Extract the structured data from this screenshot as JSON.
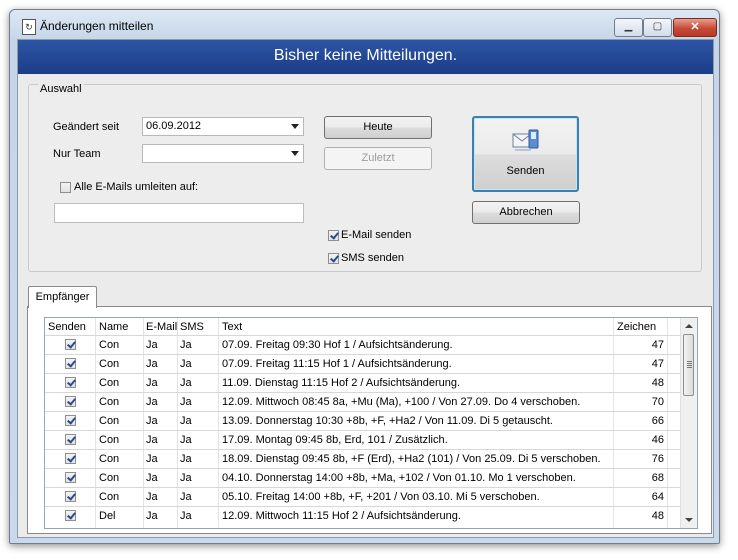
{
  "window": {
    "title": "Änderungen mitteilen",
    "app_icon_glyph": "↻"
  },
  "window_buttons": {
    "minimize": "▁",
    "maximize": "▢",
    "close": "✕"
  },
  "banner": "Bisher keine Mitteilungen.",
  "auswahl": {
    "legend": "Auswahl",
    "changed_since_label": "Geändert seit",
    "changed_since_value": "06.09.2012",
    "team_label": "Nur Team",
    "team_value": "",
    "redirect_label": "Alle E-Mails umleiten auf:",
    "redirect_checked": false,
    "redirect_value": "",
    "today_button": "Heute",
    "last_button": "Zuletzt",
    "email_send_label": "E-Mail senden",
    "email_send_checked": true,
    "sms_send_label": "SMS senden",
    "sms_send_checked": true,
    "send_button": "Senden",
    "cancel_button": "Abbrechen"
  },
  "tab": {
    "label": "Empfänger"
  },
  "table": {
    "columns": [
      "Senden",
      "Name",
      "E-Mail",
      "SMS",
      "Text",
      "Zeichen"
    ],
    "rows": [
      {
        "send": true,
        "name": "Con",
        "email": "Ja",
        "sms": "Ja",
        "text": "07.09. Freitag 09:30 Hof 1 / Aufsichtsänderung.",
        "chars": "47"
      },
      {
        "send": true,
        "name": "Con",
        "email": "Ja",
        "sms": "Ja",
        "text": "07.09. Freitag 11:15 Hof 1 / Aufsichtsänderung.",
        "chars": "47"
      },
      {
        "send": true,
        "name": "Con",
        "email": "Ja",
        "sms": "Ja",
        "text": "11.09. Dienstag 11:15 Hof 2 / Aufsichtsänderung.",
        "chars": "48"
      },
      {
        "send": true,
        "name": "Con",
        "email": "Ja",
        "sms": "Ja",
        "text": "12.09. Mittwoch 08:45 8a, +Mu (Ma), +100 / Von 27.09. Do 4 verschoben.",
        "chars": "70"
      },
      {
        "send": true,
        "name": "Con",
        "email": "Ja",
        "sms": "Ja",
        "text": "13.09. Donnerstag 10:30 +8b, +F, +Ha2 / Von 11.09. Di 5 getauscht.",
        "chars": "66"
      },
      {
        "send": true,
        "name": "Con",
        "email": "Ja",
        "sms": "Ja",
        "text": "17.09. Montag 09:45 8b, Erd, 101 / Zusätzlich.",
        "chars": "46"
      },
      {
        "send": true,
        "name": "Con",
        "email": "Ja",
        "sms": "Ja",
        "text": "18.09. Dienstag 09:45 8b, +F (Erd), +Ha2 (101) / Von 25.09. Di 5 verschoben.",
        "chars": "76"
      },
      {
        "send": true,
        "name": "Con",
        "email": "Ja",
        "sms": "Ja",
        "text": "04.10. Donnerstag 14:00 +8b, +Ma, +102 / Von 01.10. Mo 1 verschoben.",
        "chars": "68"
      },
      {
        "send": true,
        "name": "Con",
        "email": "Ja",
        "sms": "Ja",
        "text": "05.10. Freitag 14:00 +8b, +F, +201 / Von 03.10. Mi 5 verschoben.",
        "chars": "64"
      },
      {
        "send": true,
        "name": "Del",
        "email": "Ja",
        "sms": "Ja",
        "text": "12.09. Mittwoch 11:15 Hof 2 / Aufsichtsänderung.",
        "chars": "48"
      }
    ]
  }
}
